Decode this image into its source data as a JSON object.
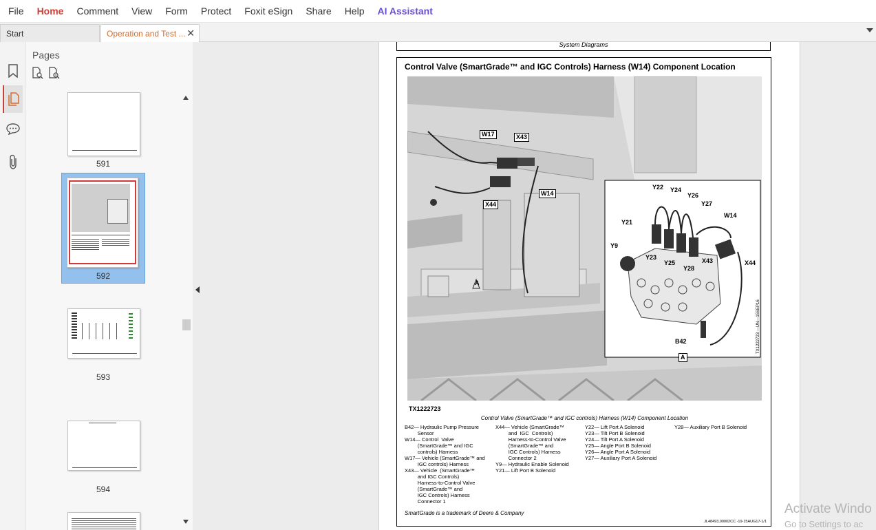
{
  "menubar": {
    "items": [
      "File",
      "Home",
      "Comment",
      "View",
      "Form",
      "Protect",
      "Foxit eSign",
      "Share",
      "Help",
      "AI Assistant"
    ]
  },
  "tabs": {
    "start": "Start",
    "document": "Operation and Test ..."
  },
  "rail": {
    "icons": [
      "bookmark-icon",
      "pages-icon",
      "comment-icon",
      "attachment-icon"
    ]
  },
  "pages_panel": {
    "title": "Pages",
    "thumbnails": [
      "591",
      "592",
      "593",
      "594"
    ],
    "selected": "592"
  },
  "document": {
    "header_text": "System Diagrams",
    "title": "Control Valve (SmartGrade™ and IGC Controls) Harness (W14) Component Location",
    "figure_id": "TX1222723",
    "side_code": "TX1222723 —UN—15SEP16",
    "caption": "Control Valve (SmartGrade™ and IGC controls) Harness (W14) Component Location",
    "callouts_main": [
      "W17",
      "X43",
      "W14",
      "X44",
      "A"
    ],
    "callouts_inset": [
      "Y22",
      "Y24",
      "Y26",
      "Y27",
      "W14",
      "Y21",
      "Y9",
      "Y23",
      "Y25",
      "Y28",
      "X43",
      "X44",
      "B42",
      "A"
    ],
    "legend": {
      "col1": [
        "B42— Hydraulic Pump Pressure",
        "         Sensor",
        "W14— Control  Valve",
        "         (SmartGrade™ and IGC",
        "         controls) Harness",
        "W17— Vehicle (SmartGrade™ and",
        "         IGC controls) Harness",
        "X43— Vehicle  (SmartGrade™",
        "         and IGC Controls)",
        "         Harness-to-Control Valve",
        "         (SmartGrade™ and",
        "         IGC Controls) Harness",
        "         Connector 1"
      ],
      "col2": [
        "X44— Vehicle (SmartGrade™",
        "         and  IGC  Controls)",
        "         Harness-to-Control Valve",
        "         (SmartGrade™ and",
        "         IGC Controls) Harness",
        "         Connector 2",
        "Y9— Hydraulic Enable Solenoid",
        "Y21— Lift Port B Solenoid"
      ],
      "col3": [
        "Y22— Lift Port A Solenoid",
        "Y23— Tilt Port B Solenoid",
        "Y24— Tilt Port A Solenoid",
        "Y25— Angle Port B Solenoid",
        "Y26— Angle Port A Solenoid",
        "Y27— Auxiliary Port A Solenoid"
      ],
      "col4": [
        "Y28— Auxiliary Port B Solenoid"
      ]
    },
    "footnote": "SmartGrade is a trademark of Deere & Company",
    "footcode": "JL48493,00002CC -19-15AUG17-1/1"
  },
  "watermark": {
    "line1": "Activate Windo",
    "line2": "Go to Settings to ac"
  },
  "colors": {
    "accent": "#c9403a",
    "ai": "#6a4ed6",
    "selection": "#93c0ec"
  }
}
